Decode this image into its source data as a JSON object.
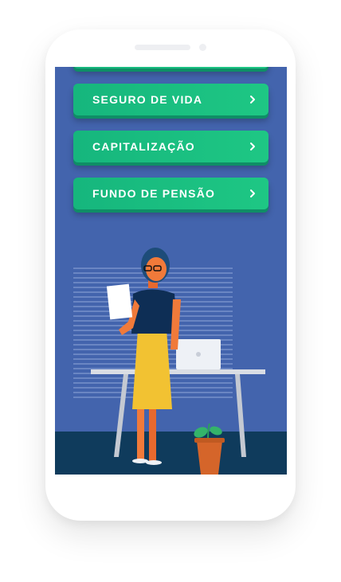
{
  "menu": {
    "items": [
      {
        "label": "SEGURO DE VIDA"
      },
      {
        "label": "CAPITALIZAÇÃO"
      },
      {
        "label": "FUNDO DE PENSÃO"
      }
    ]
  },
  "colors": {
    "screen_bg": "#4364ad",
    "button_green": "#1ec784",
    "floor": "#0f3b5c"
  }
}
